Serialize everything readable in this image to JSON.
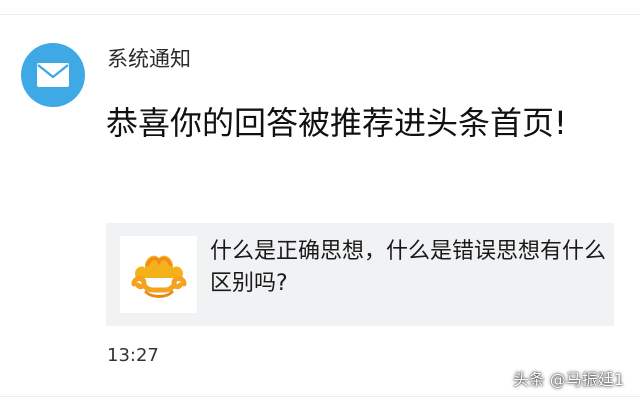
{
  "notification": {
    "sender": "系统通知",
    "message": "恭喜你的回答被推荐进头条首页!",
    "time": "13:27",
    "icon": "mail-icon",
    "avatar_color": "#3fa9e6"
  },
  "card": {
    "title": "什么是正确思想，什么是错误思想有什么区别吗?",
    "thumbnail_icon": "cloud-logo-icon"
  },
  "watermark": "头条 @马振廷1"
}
